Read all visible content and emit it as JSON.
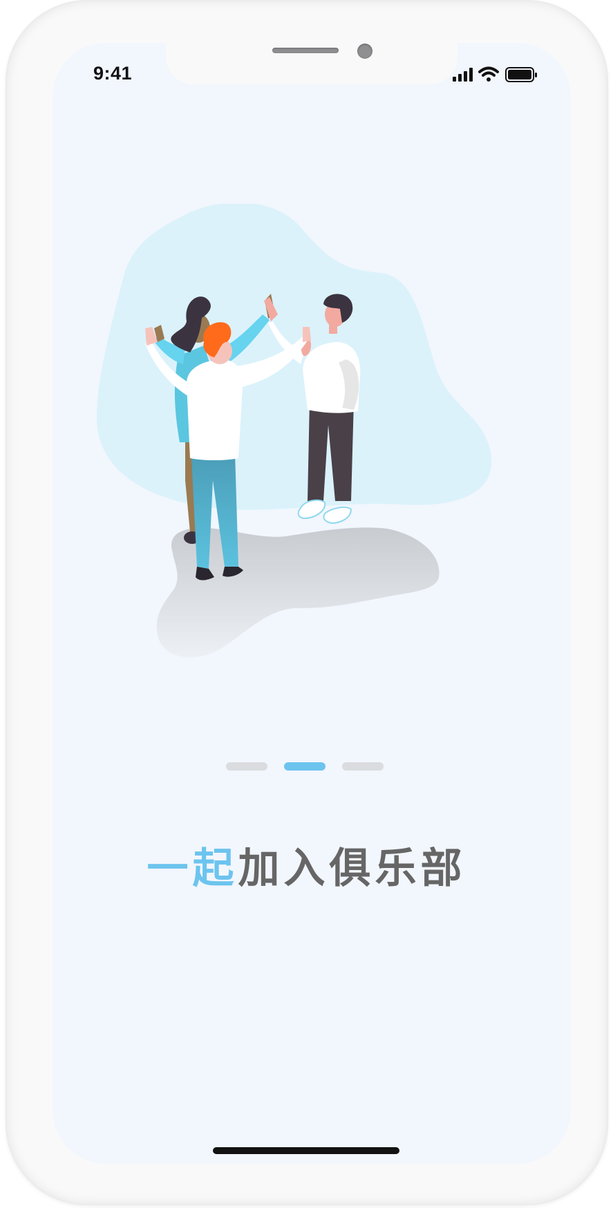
{
  "status_bar": {
    "time": "9:41",
    "icons": [
      "signal-icon",
      "wifi-icon",
      "battery-icon"
    ]
  },
  "illustration": {
    "icon": "people-high-five-illustration"
  },
  "pager": {
    "count": 3,
    "active_index": 1,
    "active_color": "#6cc4ee",
    "inactive_color": "#dadcdf"
  },
  "headline": {
    "accent_text": "一起",
    "rest_text": "加入俱乐部",
    "accent_color": "#6cc4ee",
    "rest_color": "#666666"
  }
}
